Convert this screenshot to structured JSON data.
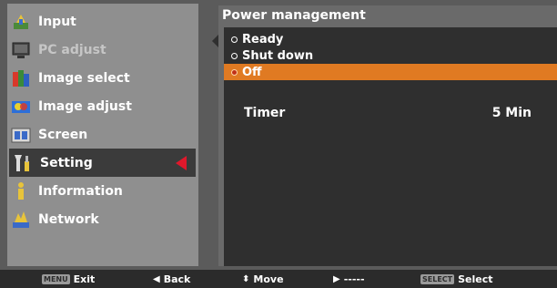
{
  "menu": {
    "items": [
      {
        "label": "Input",
        "icon": "input-icon",
        "state": "normal"
      },
      {
        "label": "PC adjust",
        "icon": "pc-adjust-icon",
        "state": "disabled"
      },
      {
        "label": "Image select",
        "icon": "image-select-icon",
        "state": "normal"
      },
      {
        "label": "Image adjust",
        "icon": "image-adjust-icon",
        "state": "normal"
      },
      {
        "label": "Screen",
        "icon": "screen-icon",
        "state": "normal"
      },
      {
        "label": "Setting",
        "icon": "setting-icon",
        "state": "active"
      },
      {
        "label": "Information",
        "icon": "information-icon",
        "state": "normal"
      },
      {
        "label": "Network",
        "icon": "network-icon",
        "state": "normal"
      }
    ]
  },
  "panel": {
    "title": "Power management",
    "options": [
      {
        "label": "Ready",
        "selected": false
      },
      {
        "label": "Shut down",
        "selected": false
      },
      {
        "label": "Off",
        "selected": true
      }
    ],
    "timer_label": "Timer",
    "timer_value": "5 Min"
  },
  "bottom_bar": {
    "exit_key": "MENU",
    "exit_label": "Exit",
    "back_label": "Back",
    "move_label": "Move",
    "next_label": "-----",
    "select_key": "SELECT",
    "select_label": "Select"
  },
  "colors": {
    "accent_orange": "#e07a22",
    "arrow_red": "#e0182b"
  }
}
